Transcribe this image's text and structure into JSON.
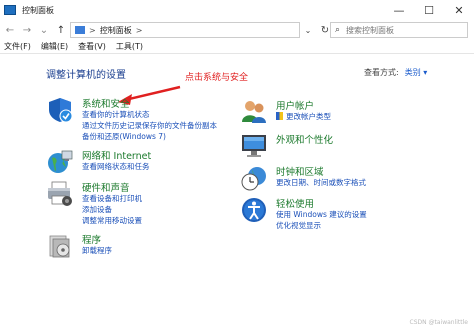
{
  "window": {
    "title": "控制面板",
    "minimize": "—",
    "maximize": "☐",
    "close": "✕"
  },
  "nav": {
    "back": "←",
    "forward": "→",
    "recent": "⌄",
    "up": "↑",
    "breadcrumb": "控制面板",
    "separator": ">",
    "dropdown": "⌄",
    "refresh": "↻",
    "search_placeholder": "搜索控制面板"
  },
  "menu": [
    "文件(F)",
    "编辑(E)",
    "查看(V)",
    "工具(T)"
  ],
  "main": {
    "heading": "调整计算机的设置",
    "view_by_label": "查看方式:",
    "view_by_value": "类别 ▾"
  },
  "annotation": {
    "text": "点击系统与安全",
    "color": "#e02020"
  },
  "categories": {
    "system_security": {
      "title": "系统和安全",
      "links": [
        "查看你的计算机状态",
        "通过文件历史记录保存你的文件备份副本",
        "备份和还原(Windows 7)"
      ]
    },
    "network": {
      "title": "网络和 Internet",
      "links": [
        "查看网络状态和任务"
      ]
    },
    "hardware": {
      "title": "硬件和声音",
      "links": [
        "查看设备和打印机",
        "添加设备",
        "调整常用移动设置"
      ]
    },
    "programs": {
      "title": "程序",
      "links": [
        "卸载程序"
      ]
    },
    "user_accounts": {
      "title": "用户帐户",
      "links": [
        "更改帐户类型"
      ]
    },
    "appearance": {
      "title": "外观和个性化",
      "links": []
    },
    "clock_region": {
      "title": "时钟和区域",
      "links": [
        "更改日期、时间或数字格式"
      ]
    },
    "ease_of_access": {
      "title": "轻松使用",
      "links": [
        "使用 Windows 建议的设置",
        "优化视觉显示"
      ]
    }
  },
  "watermark": "CSDN @taiwanlittle",
  "icons": [
    "folder-icon",
    "search-icon",
    "refresh-icon",
    "shield-icon",
    "globe-icon",
    "printer-icon",
    "programs-icon",
    "users-icon",
    "monitor-icon",
    "clock-icon",
    "accessibility-icon"
  ]
}
